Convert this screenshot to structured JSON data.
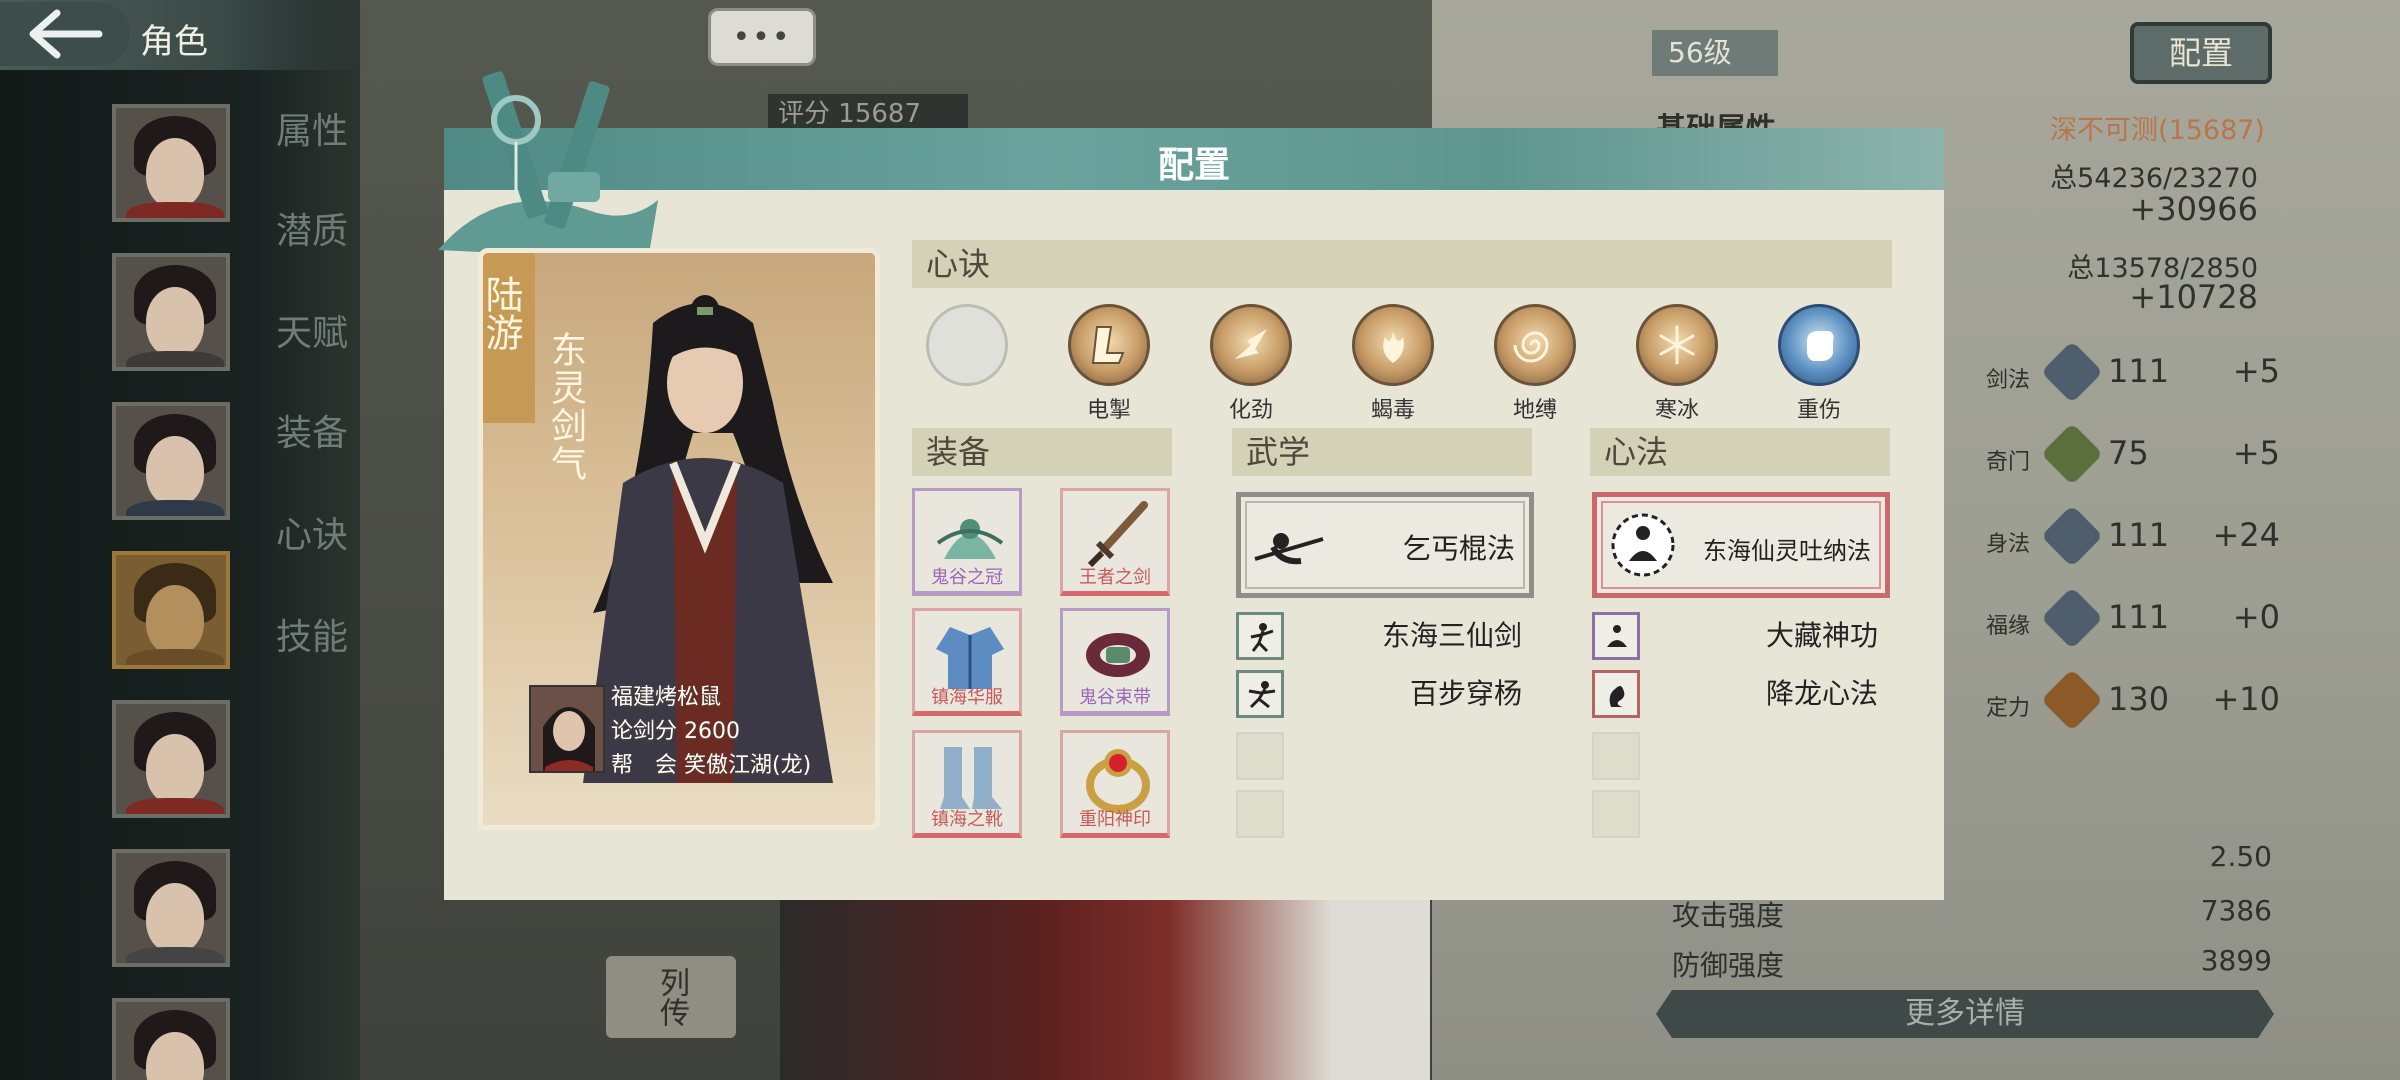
{
  "topbar": {
    "title": "角色"
  },
  "sidebar": {
    "tabs": [
      "属性",
      "潜质",
      "天赋",
      "装备",
      "心诀",
      "技能"
    ]
  },
  "background": {
    "chat_dots": "•••",
    "score_label": "评分",
    "score_value": "15687",
    "level": "56级",
    "config_button": "配置",
    "base_attr_label": "基础属性",
    "power_label": "深不可测(15687)",
    "stat_lines": [
      {
        "top": "总54236/23270",
        "big": "+30966"
      },
      {
        "top": "总13578/2850",
        "big": "+10728"
      }
    ],
    "stats": [
      {
        "label": "剑法",
        "value": "111",
        "bonus": "+5"
      },
      {
        "label": "奇门",
        "value": "75",
        "bonus": "+5"
      },
      {
        "label": "身法",
        "value": "111",
        "bonus": "+24"
      },
      {
        "label": "福缘",
        "value": "111",
        "bonus": "+0"
      },
      {
        "label": "定力",
        "value": "130",
        "bonus": "+10"
      }
    ],
    "bottom_stats": [
      {
        "label": "",
        "value": "2.50"
      },
      {
        "label": "攻击强度",
        "value": "7386"
      },
      {
        "label": "防御强度",
        "value": "3899"
      }
    ],
    "more_details": "更多详情",
    "liezhuan": "列传"
  },
  "modal": {
    "title": "配置",
    "character": {
      "name": "陆游",
      "title": "东灵剑气",
      "player_name": "福建烤松鼠",
      "duel_score_label": "论剑分",
      "duel_score": "2600",
      "guild_label": "帮　会",
      "guild": "笑傲江湖(龙)"
    },
    "xinjue": {
      "header": "心诀",
      "slots": [
        {
          "label": "",
          "icon": "empty-slot"
        },
        {
          "label": "电掣",
          "icon": "lightning-icon"
        },
        {
          "label": "化劲",
          "icon": "force-icon"
        },
        {
          "label": "蝎毒",
          "icon": "scorpion-icon"
        },
        {
          "label": "地缚",
          "icon": "spiral-icon"
        },
        {
          "label": "寒冰",
          "icon": "snowflake-icon"
        },
        {
          "label": "重伤",
          "icon": "fist-icon"
        }
      ]
    },
    "equipment": {
      "header": "装备",
      "items": [
        {
          "name": "鬼谷之冠",
          "quality": "purple"
        },
        {
          "name": "王者之剑",
          "quality": "red"
        },
        {
          "name": "镇海华服",
          "quality": "red"
        },
        {
          "name": "鬼谷束带",
          "quality": "purple"
        },
        {
          "name": "镇海之靴",
          "quality": "red"
        },
        {
          "name": "重阳神印",
          "quality": "red"
        }
      ]
    },
    "wuxue": {
      "header": "武学",
      "main": "乞丐棍法",
      "secondary": [
        "东海三仙剑",
        "百步穿杨"
      ]
    },
    "xinfa": {
      "header": "心法",
      "main": "东海仙灵吐纳法",
      "secondary": [
        "大藏神功",
        "降龙心法"
      ]
    }
  }
}
